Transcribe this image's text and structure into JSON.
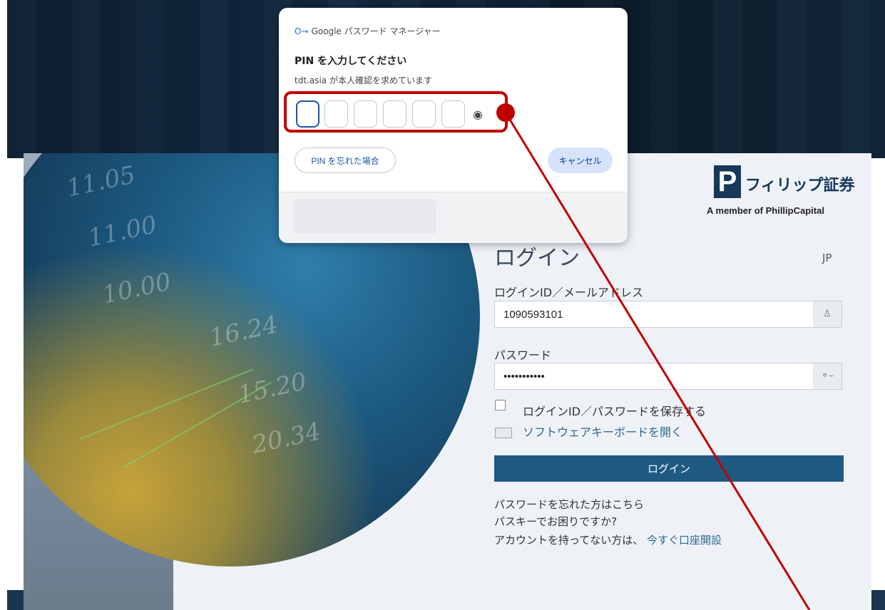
{
  "password_manager": {
    "header": "Google パスワード マネージャー",
    "title": "PIN を入力してください",
    "subtitle": "tdt.asia が本人確認を求めています",
    "pin_length": 6,
    "forgot_label": "PIN を忘れた場合",
    "cancel_label": "キャンセル"
  },
  "logo": {
    "mark": "P",
    "name_jp": "フィリップ証券",
    "tagline": "A member of PhillipCapital"
  },
  "login": {
    "title": "ログイン",
    "language": "JP",
    "id_label": "ログインID／メールアドレス",
    "id_value": "1090593101",
    "password_label": "パスワード",
    "password_value": "•••••••••••",
    "remember_label": "ログインID／パスワードを保存する",
    "remember_checked": false,
    "software_keyboard_label": "ソフトウェアキーボードを開く",
    "submit_label": "ログイン",
    "forgot_password": "パスワードを忘れた方はこちら",
    "passkey_help": "パスキーでお困りですか?",
    "no_account_text": "アカウントを持ってない方は、",
    "open_account_link": "今すぐ口座開設"
  },
  "colors": {
    "annotation": "#c00000",
    "primary_button": "#1e5a82",
    "brand": "#16385b"
  },
  "icons": {
    "key": "key-icon",
    "eye": "eye-icon",
    "user": "user-icon",
    "keyboard": "keyboard-icon"
  }
}
